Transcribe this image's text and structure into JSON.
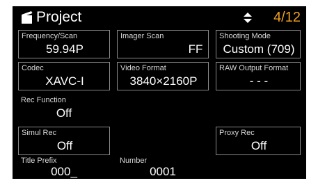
{
  "header": {
    "icon": "clapperboard-document-icon",
    "title": "Project",
    "sort_icon": "up-down-arrows-icon",
    "page_indicator": "4/12",
    "accent_color": "#f0a020"
  },
  "settings": {
    "frequency_scan": {
      "label": "Frequency/Scan",
      "value": "59.94P"
    },
    "imager_scan": {
      "label": "Imager Scan",
      "value": "FF"
    },
    "shooting_mode": {
      "label": "Shooting Mode",
      "value": "Custom (709)"
    },
    "codec": {
      "label": "Codec",
      "value": "XAVC-I"
    },
    "video_format": {
      "label": "Video Format",
      "value": "3840×2160P"
    },
    "raw_output_format": {
      "label": "RAW Output Format",
      "value": "- - -"
    },
    "rec_function": {
      "label": "Rec Function",
      "value": "Off"
    },
    "simul_rec": {
      "label": "Simul Rec",
      "value": "Off"
    },
    "proxy_rec": {
      "label": "Proxy Rec",
      "value": "Off"
    },
    "title_prefix": {
      "label": "Title Prefix",
      "value": "000_"
    },
    "number": {
      "label": "Number",
      "value": "0001"
    }
  }
}
